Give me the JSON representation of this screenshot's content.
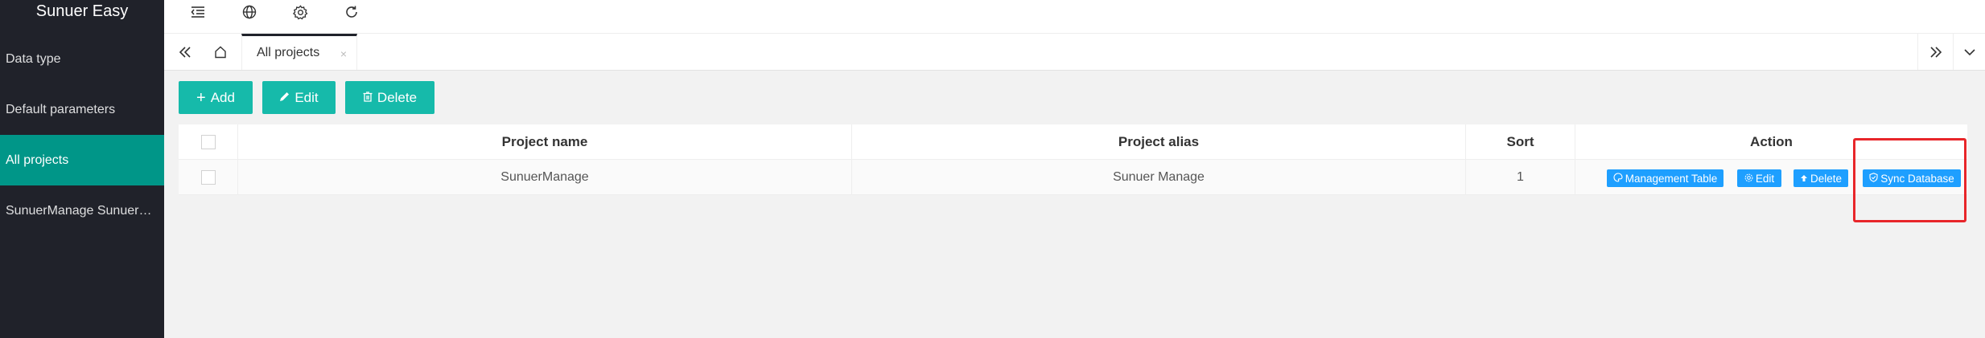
{
  "app": {
    "title": "Sunuer Easy"
  },
  "sidebar": {
    "items": [
      {
        "label": "Data type"
      },
      {
        "label": "Default parameters"
      },
      {
        "label": "All projects"
      },
      {
        "label": "SunuerManage SunuerManage"
      }
    ]
  },
  "header": {
    "icons": [
      "menu-fold-icon",
      "globe-icon",
      "gear-icon",
      "refresh-icon"
    ]
  },
  "tabs": {
    "active_label": "All projects",
    "close_glyph": "×"
  },
  "toolbar": {
    "add_label": "Add",
    "edit_label": "Edit",
    "delete_label": "Delete",
    "color": "#16baaa"
  },
  "table": {
    "columns": [
      "Project name",
      "Project alias",
      "Sort",
      "Action"
    ],
    "rows": [
      {
        "name": "SunuerManage",
        "alias": "Sunuer Manage",
        "sort": "1"
      }
    ],
    "actions": {
      "management_table": "Management Table",
      "edit": "Edit",
      "delete": "Delete",
      "sync_database": "Sync Database"
    }
  },
  "colors": {
    "sidebar_bg": "#20222a",
    "active_nav": "#009688",
    "action_btn": "#1e9fff",
    "highlight": "#e8262a"
  }
}
